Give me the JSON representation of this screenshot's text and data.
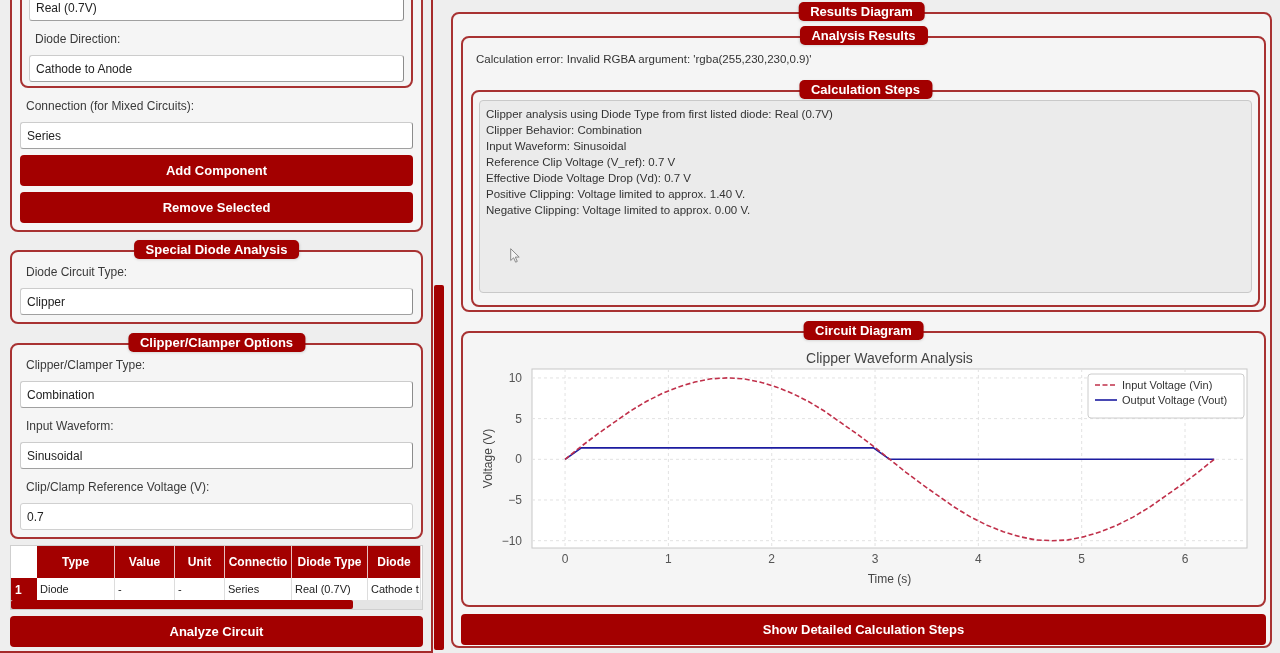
{
  "left_panel": {
    "component_form": {
      "diode_settings": {
        "fields": [
          {
            "kind": "dropdown",
            "value": "Real (0.7V)"
          },
          {
            "kind": "dropdown",
            "label": "Diode Direction:",
            "value": "Cathode to Anode"
          }
        ]
      },
      "connection": {
        "kind": "dropdown",
        "label": "Connection (for Mixed Circuits):",
        "value": "Series"
      },
      "buttons": [
        "Add Component",
        "Remove Selected"
      ]
    },
    "sections": [
      {
        "title": "Special Diode Analysis",
        "fields": [
          {
            "kind": "dropdown",
            "label": "Diode Circuit Type:",
            "value": "Clipper"
          }
        ]
      },
      {
        "title": "Clipper/Clamper Options",
        "fields": [
          {
            "kind": "dropdown",
            "label": "Clipper/Clamper Type:",
            "value": "Combination"
          },
          {
            "kind": "dropdown",
            "label": "Input Waveform:",
            "value": "Sinusoidal"
          },
          {
            "kind": "text",
            "label": "Clip/Clamp Reference Voltage (V):",
            "value": "0.7"
          }
        ]
      }
    ],
    "components_table": {
      "columns": [
        "Type",
        "Value",
        "Unit",
        "Connectio",
        "Diode Type",
        "Diode"
      ],
      "rows": [
        {
          "header": "1",
          "cells": [
            "Diode",
            "-",
            "-",
            "Series",
            "Real (0.7V)",
            "Cathode t"
          ]
        }
      ]
    },
    "analyze_button": "Analyze Circuit"
  },
  "right_panel": {
    "title": "Results Diagram",
    "analysis_results": {
      "title": "Analysis Results",
      "message": "Calculation error: Invalid RGBA argument: 'rgba(255,230,230,0.9)'",
      "calculation_steps": {
        "title": "Calculation Steps",
        "lines": [
          "Clipper analysis using Diode Type from first listed diode: Real (0.7V)",
          "Clipper Behavior: Combination",
          "Input Waveform: Sinusoidal",
          "Reference Clip Voltage (V_ref): 0.7 V",
          "Effective Diode Voltage Drop (Vd): 0.7 V",
          "Positive Clipping: Voltage limited to approx. 1.40 V.",
          "Negative Clipping: Voltage limited to approx. 0.00 V."
        ]
      }
    },
    "circuit_diagram": {
      "title": "Circuit Diagram",
      "chart_data": {
        "type": "line",
        "title": "Clipper Waveform Analysis",
        "xlabel": "Time (s)",
        "ylabel": "Voltage (V)",
        "x": [
          0,
          0.157,
          0.314,
          0.471,
          0.628,
          0.785,
          0.942,
          1.1,
          1.257,
          1.414,
          1.571,
          1.728,
          1.885,
          2.042,
          2.199,
          2.356,
          2.513,
          2.67,
          2.827,
          2.985,
          3.142,
          3.299,
          3.456,
          3.613,
          3.77,
          3.927,
          4.084,
          4.241,
          4.398,
          4.555,
          4.712,
          4.869,
          5.027,
          5.184,
          5.341,
          5.498,
          5.655,
          5.812,
          5.969,
          6.126,
          6.283
        ],
        "series": [
          {
            "name": "Input Voltage (Vin)",
            "color": "#c0304a",
            "line_style": "dashed",
            "values": [
              0,
              1.6,
              3.1,
              4.5,
              5.9,
              7.1,
              8.1,
              8.9,
              9.5,
              9.9,
              10,
              9.9,
              9.5,
              8.9,
              8.1,
              7.1,
              5.9,
              4.5,
              3.1,
              1.6,
              0,
              -1.6,
              -3.1,
              -4.5,
              -5.9,
              -7.1,
              -8.1,
              -8.9,
              -9.5,
              -9.9,
              -10,
              -9.9,
              -9.5,
              -8.9,
              -8.1,
              -7.1,
              -5.9,
              -4.5,
              -3.1,
              -1.6,
              0
            ]
          },
          {
            "name": "Output Voltage (Vout)",
            "color": "#1c1ca0",
            "line_style": "solid",
            "values": [
              0,
              1.4,
              1.4,
              1.4,
              1.4,
              1.4,
              1.4,
              1.4,
              1.4,
              1.4,
              1.4,
              1.4,
              1.4,
              1.4,
              1.4,
              1.4,
              1.4,
              1.4,
              1.4,
              1.4,
              0,
              0,
              0,
              0,
              0,
              0,
              0,
              0,
              0,
              0,
              0,
              0,
              0,
              0,
              0,
              0,
              0,
              0,
              0,
              0,
              0
            ]
          }
        ],
        "xlim": [
          -0.32,
          6.6
        ],
        "ylim": [
          -10.9,
          11.1
        ],
        "xticks": [
          0,
          1,
          2,
          3,
          4,
          5,
          6
        ],
        "yticks": [
          {
            "value": -10,
            "label": "−10"
          },
          {
            "value": -5,
            "label": "−5"
          },
          0,
          5,
          10
        ],
        "grid": true,
        "legend": true
      }
    },
    "details_button": "Show Detailed Calculation Steps"
  }
}
